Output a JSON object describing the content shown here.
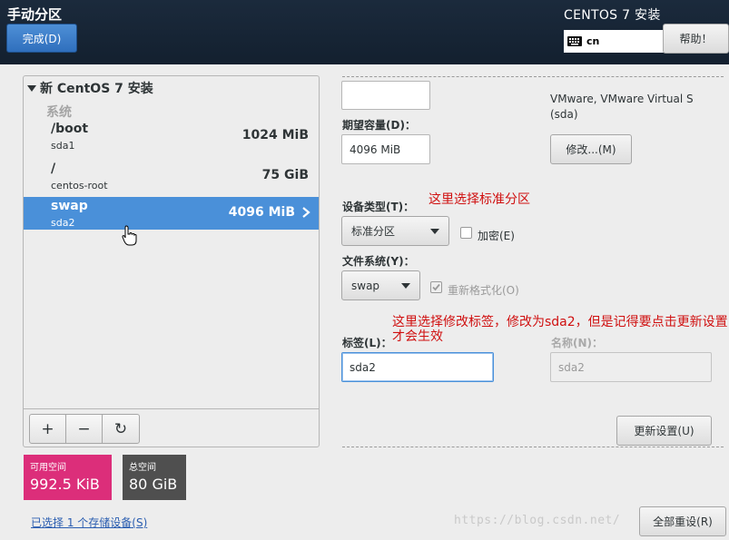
{
  "header": {
    "title": "手动分区",
    "done_label": "完成(D)",
    "product": "CENTOS 7 安装",
    "keyboard_layout": "cn",
    "help_label": "帮助！"
  },
  "tree": {
    "root_label": "新 CentOS 7 安装",
    "section_label": "系统",
    "mounts": [
      {
        "name": "/boot",
        "device": "sda1",
        "size": "1024 MiB"
      },
      {
        "name": "/",
        "device": "centos-root",
        "size": "75 GiB"
      },
      {
        "name": "swap",
        "device": "sda2",
        "size": "4096 MiB",
        "selected": true
      }
    ],
    "toolbar": {
      "add": "+",
      "remove": "−",
      "refresh": "↻"
    }
  },
  "space": {
    "available_label": "可用空间",
    "available_value": "992.5 KiB",
    "total_label": "总空间",
    "total_value": "80 GiB"
  },
  "storage_link": "已选择 1 个存储设备(S)",
  "details": {
    "mount_point_value": "",
    "capacity_label": "期望容量(D)：",
    "capacity_value": "4096 MiB",
    "disk_info": "VMware, VMware Virtual S (sda)",
    "modify_label": "修改...(M)",
    "device_type_label": "设备类型(T)：",
    "device_type_value": "标准分区",
    "encrypt_label": "加密(E)",
    "filesystem_label": "文件系统(Y)：",
    "filesystem_value": "swap",
    "reformat_label": "重新格式化(O)",
    "tag_label": "标签(L)：",
    "tag_value": "sda2",
    "name_label": "名称(N)：",
    "name_value": "sda2",
    "update_label": "更新设置(U)",
    "reset_label": "全部重设(R)"
  },
  "annotations": {
    "device_type_note": "这里选择标准分区",
    "tag_note": "这里选择修改标签，修改为sda2，但是记得要点击更新设置才会生效"
  },
  "watermark": "https://blog.csdn.net/"
}
